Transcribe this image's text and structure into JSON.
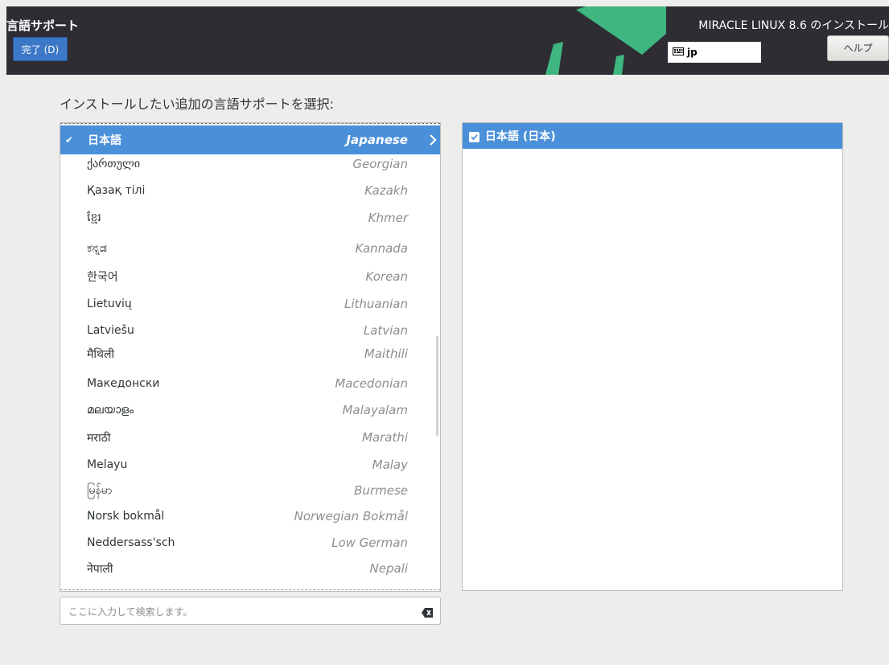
{
  "header": {
    "title": "言語サポート",
    "done_label": "完了 (D)",
    "product_title": "MIRACLE LINUX 8.6 のインストール",
    "keyboard_layout": "jp",
    "help_label": "ヘルプ",
    "logo_color": "#3fb57f"
  },
  "main": {
    "prompt": "インストールしたい追加の言語サポートを選択:",
    "languages": [
      {
        "native": "日本語",
        "english": "Japanese",
        "selected": true
      },
      {
        "native": "ქართული",
        "english": "Georgian"
      },
      {
        "native": "Қазақ тілі",
        "english": "Kazakh"
      },
      {
        "native": "ខ្មែរ",
        "english": "Khmer"
      },
      {
        "native": "ಕನ್ನಡ",
        "english": "Kannada"
      },
      {
        "native": "한국어",
        "english": "Korean"
      },
      {
        "native": "Lietuvių",
        "english": "Lithuanian"
      },
      {
        "native": "Latviešu",
        "english": "Latvian"
      },
      {
        "native": "मैथिली",
        "english": "Maithili"
      },
      {
        "native": "Македонски",
        "english": "Macedonian"
      },
      {
        "native": "മലയാളം",
        "english": "Malayalam"
      },
      {
        "native": "मराठी",
        "english": "Marathi"
      },
      {
        "native": "Melayu",
        "english": "Malay"
      },
      {
        "native": "မြန်မာ",
        "english": "Burmese"
      },
      {
        "native": "Norsk bokmål",
        "english": "Norwegian Bokmål"
      },
      {
        "native": "Neddersass'sch",
        "english": "Low German"
      },
      {
        "native": "नेपाली",
        "english": "Nepali"
      }
    ],
    "locales": [
      {
        "label": "日本語 (日本)",
        "checked": true
      }
    ],
    "search_placeholder": "ここに入力して検索します。"
  },
  "colors": {
    "accent": "#4a90d9",
    "header_bg": "#2e2d33",
    "done_button": "#3c78c7"
  }
}
